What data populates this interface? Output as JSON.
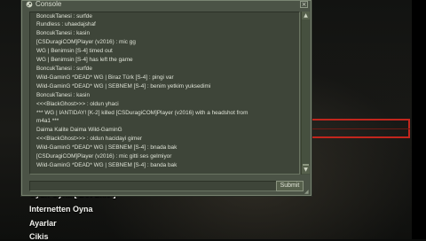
{
  "console": {
    "title": "Console",
    "close_glyph": "×",
    "icon": "steam-icon",
    "log_lines": [
      "BoncukTanesi :  surfde",
      "Rundless :  uhaedajshaf",
      "BoncukTanesi :  kasin",
      "[CSDuragiCOM]Player (v2016) :  mic gg",
      "WG | Benimsin [S-4] timed out",
      "WG | Benimsin [S-4] has left the game",
      "BoncukTanesi :  surfde",
      "Wild-GaminG *DEAD* WG | Biraz Türk [S-4] :  pingi var",
      "Wild-GaminG *DEAD* WG | SEBNEM [S-4] :  benim yetkim yuksedimi",
      "BoncukTanesi :  kasin",
      "<<<BlackGhost>>> :  oldun yhaci",
      "*** WG | IANTIDAY! [K-2] killed [CSDuragiCOM]Player (v2016) with a headshot from",
      "m4a1 ***",
      "Daima Kalite Daima Wild-GaminG",
      "<<<BlackGhost>>> :  oldun hacidayi gimer",
      "Wild-GaminG *DEAD* WG | SEBNEM [S-4] :  bnada bak",
      "[CSDuragiCOM]Player (v2016) :  mic gitti ses gelmiyor",
      "Wild-GaminG *DEAD* WG | SEBNEM [S-4] :  banda bak"
    ],
    "input_value": "",
    "submit_label": "Submit",
    "scroll_up_glyph": "▲",
    "scroll_down_glyph": "▼",
    "scroll_position": 0.98
  },
  "background_menu": {
    "items": [
      "Oyun Oyna [ Bot Ekle ]",
      "Internetten Oyna",
      "Ayarlar",
      "Cikis"
    ],
    "left_fragments": [
      "[",
      "C",
      "C",
      "P"
    ]
  },
  "colors": {
    "window_bg": "#4b5346",
    "log_bg": "#3e4539",
    "text": "#dfe3d7",
    "highlight_frame": "#c2261d"
  }
}
